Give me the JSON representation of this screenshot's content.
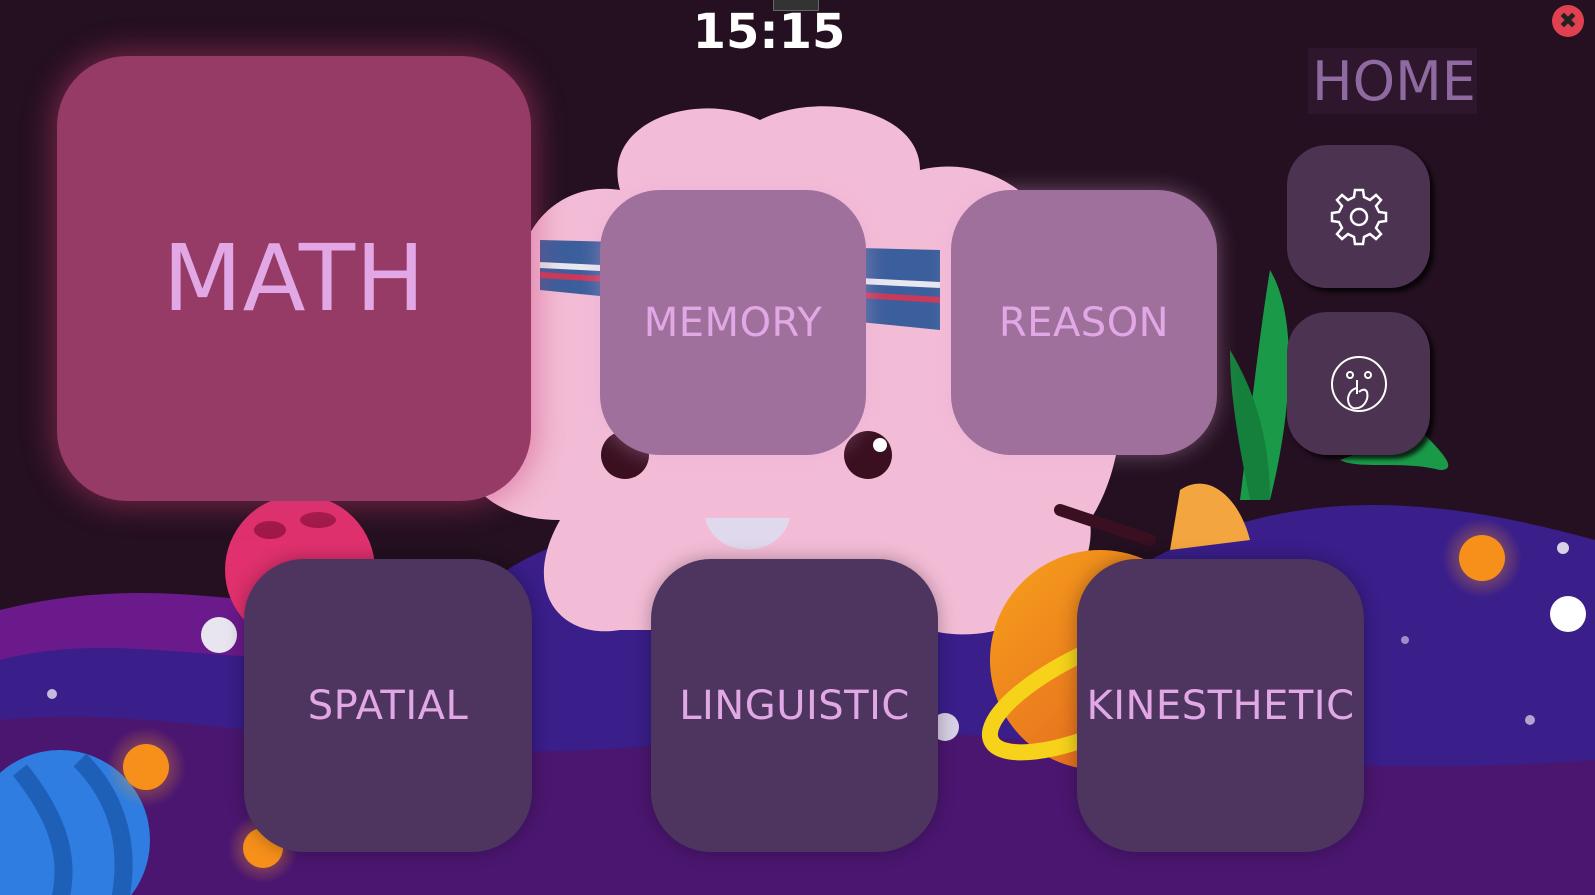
{
  "clock": "15:15",
  "header": {
    "title": "HOME"
  },
  "tiles": {
    "math": "MATH",
    "memory": "MEMORY",
    "reason": "REASON",
    "spatial": "SPATIAL",
    "linguistic": "LINGUISTIC",
    "kinesthetic": "KINESTHETIC"
  },
  "side_buttons": [
    {
      "icon": "gear-icon"
    },
    {
      "icon": "shush-face-icon"
    }
  ],
  "close": {
    "icon": "close-icon",
    "glyph": "✖"
  },
  "colors": {
    "background": "#241020",
    "math": "#963a66",
    "top_tiles": "#a0709c",
    "bottom_tiles": "#4e3560",
    "label": "#e2a8e6",
    "close": "#e0404f"
  }
}
